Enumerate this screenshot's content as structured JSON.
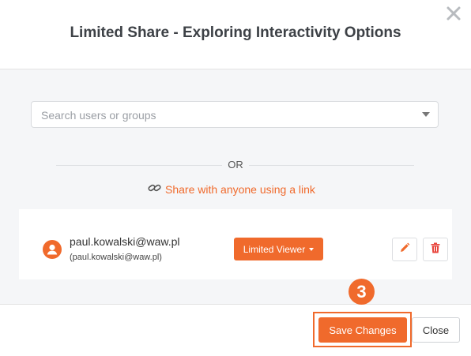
{
  "dialog": {
    "title": "Limited Share - Exploring Interactivity Options"
  },
  "search": {
    "placeholder": "Search users or groups",
    "value": ""
  },
  "separator": {
    "or_label": "OR"
  },
  "share_link": {
    "label": "Share with anyone using a link",
    "icon": "link-icon"
  },
  "user": {
    "email": "paul.kowalski@waw.pl",
    "email_sub": "(paul.kowalski@waw.pl)",
    "role_label": "Limited Viewer",
    "avatar_icon": "user-avatar-icon"
  },
  "actions": {
    "edit_icon": "pencil-icon",
    "delete_icon": "trash-icon"
  },
  "callout": {
    "step_number": "3"
  },
  "footer": {
    "save_label": "Save Changes",
    "close_label": "Close"
  },
  "colors": {
    "accent": "#f06a2c",
    "body_bg": "#f5f6f8",
    "title_text": "#3d4146"
  }
}
